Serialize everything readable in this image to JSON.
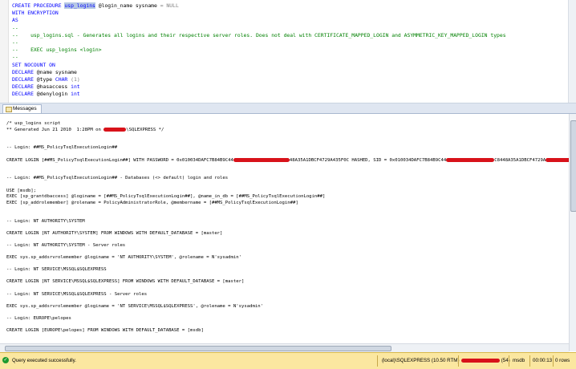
{
  "editor": {
    "lines": [
      {
        "parts": [
          {
            "t": "CREATE PROCEDURE ",
            "c": "kw"
          },
          {
            "t": "usp_logins",
            "c": "hl"
          },
          {
            "t": " @login_name sysname ",
            "c": ""
          },
          {
            "t": "= NULL",
            "c": "gr"
          }
        ]
      },
      {
        "parts": [
          {
            "t": "WITH ENCRYPTION",
            "c": "kw"
          }
        ]
      },
      {
        "parts": [
          {
            "t": "AS",
            "c": "kw"
          }
        ]
      },
      {
        "parts": [
          {
            "t": "--",
            "c": "cm"
          }
        ]
      },
      {
        "parts": [
          {
            "t": "--    usp_logins.sql - Generates all logins and their respective server roles. Does not deal with CERTIFICATE_MAPPED_LOGIN and ASYMMETRIC_KEY_MAPPED_LOGIN types",
            "c": "cm"
          }
        ]
      },
      {
        "parts": [
          {
            "t": "--",
            "c": "cm"
          }
        ]
      },
      {
        "parts": [
          {
            "t": "--    EXEC usp_logins <login>",
            "c": "cm"
          }
        ]
      },
      {
        "parts": [
          {
            "t": "--",
            "c": "cm"
          }
        ]
      },
      {
        "parts": [
          {
            "t": "SET NOCOUNT ON",
            "c": "kw"
          }
        ]
      },
      {
        "parts": [
          {
            "t": "DECLARE ",
            "c": "kw"
          },
          {
            "t": "@name sysname",
            "c": ""
          }
        ]
      },
      {
        "parts": [
          {
            "t": "DECLARE ",
            "c": "kw"
          },
          {
            "t": "@type ",
            "c": ""
          },
          {
            "t": "CHAR ",
            "c": "kw"
          },
          {
            "t": "(1)",
            "c": "gr"
          }
        ]
      },
      {
        "parts": [
          {
            "t": "DECLARE ",
            "c": "kw"
          },
          {
            "t": "@hasaccess ",
            "c": ""
          },
          {
            "t": "int",
            "c": "kw"
          }
        ]
      },
      {
        "parts": [
          {
            "t": "DECLARE ",
            "c": "kw"
          },
          {
            "t": "@denylogin ",
            "c": ""
          },
          {
            "t": "int",
            "c": "kw"
          }
        ]
      }
    ]
  },
  "tabs": {
    "messages_label": "Messages"
  },
  "messages": {
    "lines": [
      [
        "/* usp_logins script"
      ],
      [
        "** Generated Jun 21 2010  1:28PM on ",
        "#R28",
        "\\SQLEXPRESS */"
      ],
      [
        ""
      ],
      [
        ""
      ],
      [
        "-- Login: ##MS_PolicyTsqlExecutionLogin##"
      ],
      [
        ""
      ],
      [
        "CREATE LOGIN [##MS_PolicyTsqlExecutionLogin##] WITH PASSWORD = 0x010034DAFC7B84B9C44",
        "#R70",
        "48A35A1DBCF4729A435F0C HASHED, SID = 0x010034DAFC7B84B9C44",
        "#R60",
        "C8448A35A1DBCF4729A",
        "#R50",
        "0x010034D"
      ],
      [
        ""
      ],
      [
        ""
      ],
      [
        "-- Login: ##MS_PolicyTsqlExecutionLogin## - Databases (<> default) login and roles"
      ],
      [
        ""
      ],
      [
        "USE [msdb];"
      ],
      [
        "EXEC [sp_grantdbaccess] @loginame = [##MS_PolicyTsqlExecutionLogin##], @name_in_db = [##MS_PolicyTsqlExecutionLogin##]"
      ],
      [
        "EXEC [sp_addrolemember] @rolename = PolicyAdministratorRole, @membername = [##MS_PolicyTsqlExecutionLogin##]"
      ],
      [
        ""
      ],
      [
        ""
      ],
      [
        "-- Login: NT AUTHORITY\\SYSTEM"
      ],
      [
        ""
      ],
      [
        "CREATE LOGIN [NT AUTHORITY\\SYSTEM] FROM WINDOWS WITH DEFAULT_DATABASE = [master]"
      ],
      [
        ""
      ],
      [
        "-- Login: NT AUTHORITY\\SYSTEM - Server roles"
      ],
      [
        ""
      ],
      [
        "EXEC sys.sp_addsrvrolemember @loginame = 'NT AUTHORITY\\SYSTEM', @rolename = N'sysadmin'"
      ],
      [
        ""
      ],
      [
        "-- Login: NT SERVICE\\MSSQL$SQLEXPRESS"
      ],
      [
        ""
      ],
      [
        "CREATE LOGIN [NT SERVICE\\MSSQL$SQLEXPRESS] FROM WINDOWS WITH DEFAULT_DATABASE = [master]"
      ],
      [
        ""
      ],
      [
        "-- Login: NT SERVICE\\MSSQL$SQLEXPRESS - Server roles"
      ],
      [
        ""
      ],
      [
        "EXEC sys.sp_addsrvrolemember @loginame = 'NT SERVICE\\MSSQL$SQLEXPRESS', @rolename = N'sysadmin'"
      ],
      [
        ""
      ],
      [
        "-- Login: EUROPE\\pelopes"
      ],
      [
        ""
      ],
      [
        "CREATE LOGIN [EUROPE\\pelopes] FROM WINDOWS WITH DEFAULT_DATABASE = [msdb]"
      ]
    ]
  },
  "status": {
    "message": "Query executed successfully.",
    "server": "(local)\\SQLEXPRESS (10.50 RTM)",
    "spid": "(54)",
    "database": "msdb",
    "elapsed": "00:00:13",
    "rows": "0 rows"
  },
  "colors": {
    "redaction": "#d8121a",
    "status_bar": "#fbe7a0",
    "keyword": "#0000ff",
    "comment": "#008000"
  }
}
